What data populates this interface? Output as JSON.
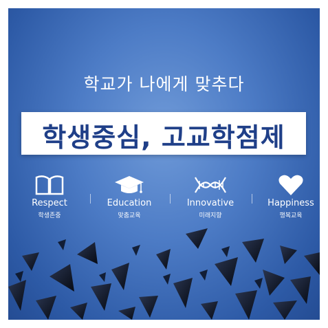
{
  "subtitle": "학교가 나에게 맞추다",
  "headline": "학생중심, 고교학점제",
  "values": [
    {
      "en": "Respect",
      "ko": "학생존중",
      "icon": "open-book-icon"
    },
    {
      "en": "Education",
      "ko": "맞춤교육",
      "icon": "graduation-cap-icon"
    },
    {
      "en": "Innovative",
      "ko": "미래지향",
      "icon": "dna-helix-icon"
    },
    {
      "en": "Happiness",
      "ko": "행복교육",
      "icon": "heart-icon"
    }
  ],
  "colors": {
    "background": "#4d7cc6",
    "headline_text": "#1f3f88",
    "shard": "#0f1522"
  }
}
